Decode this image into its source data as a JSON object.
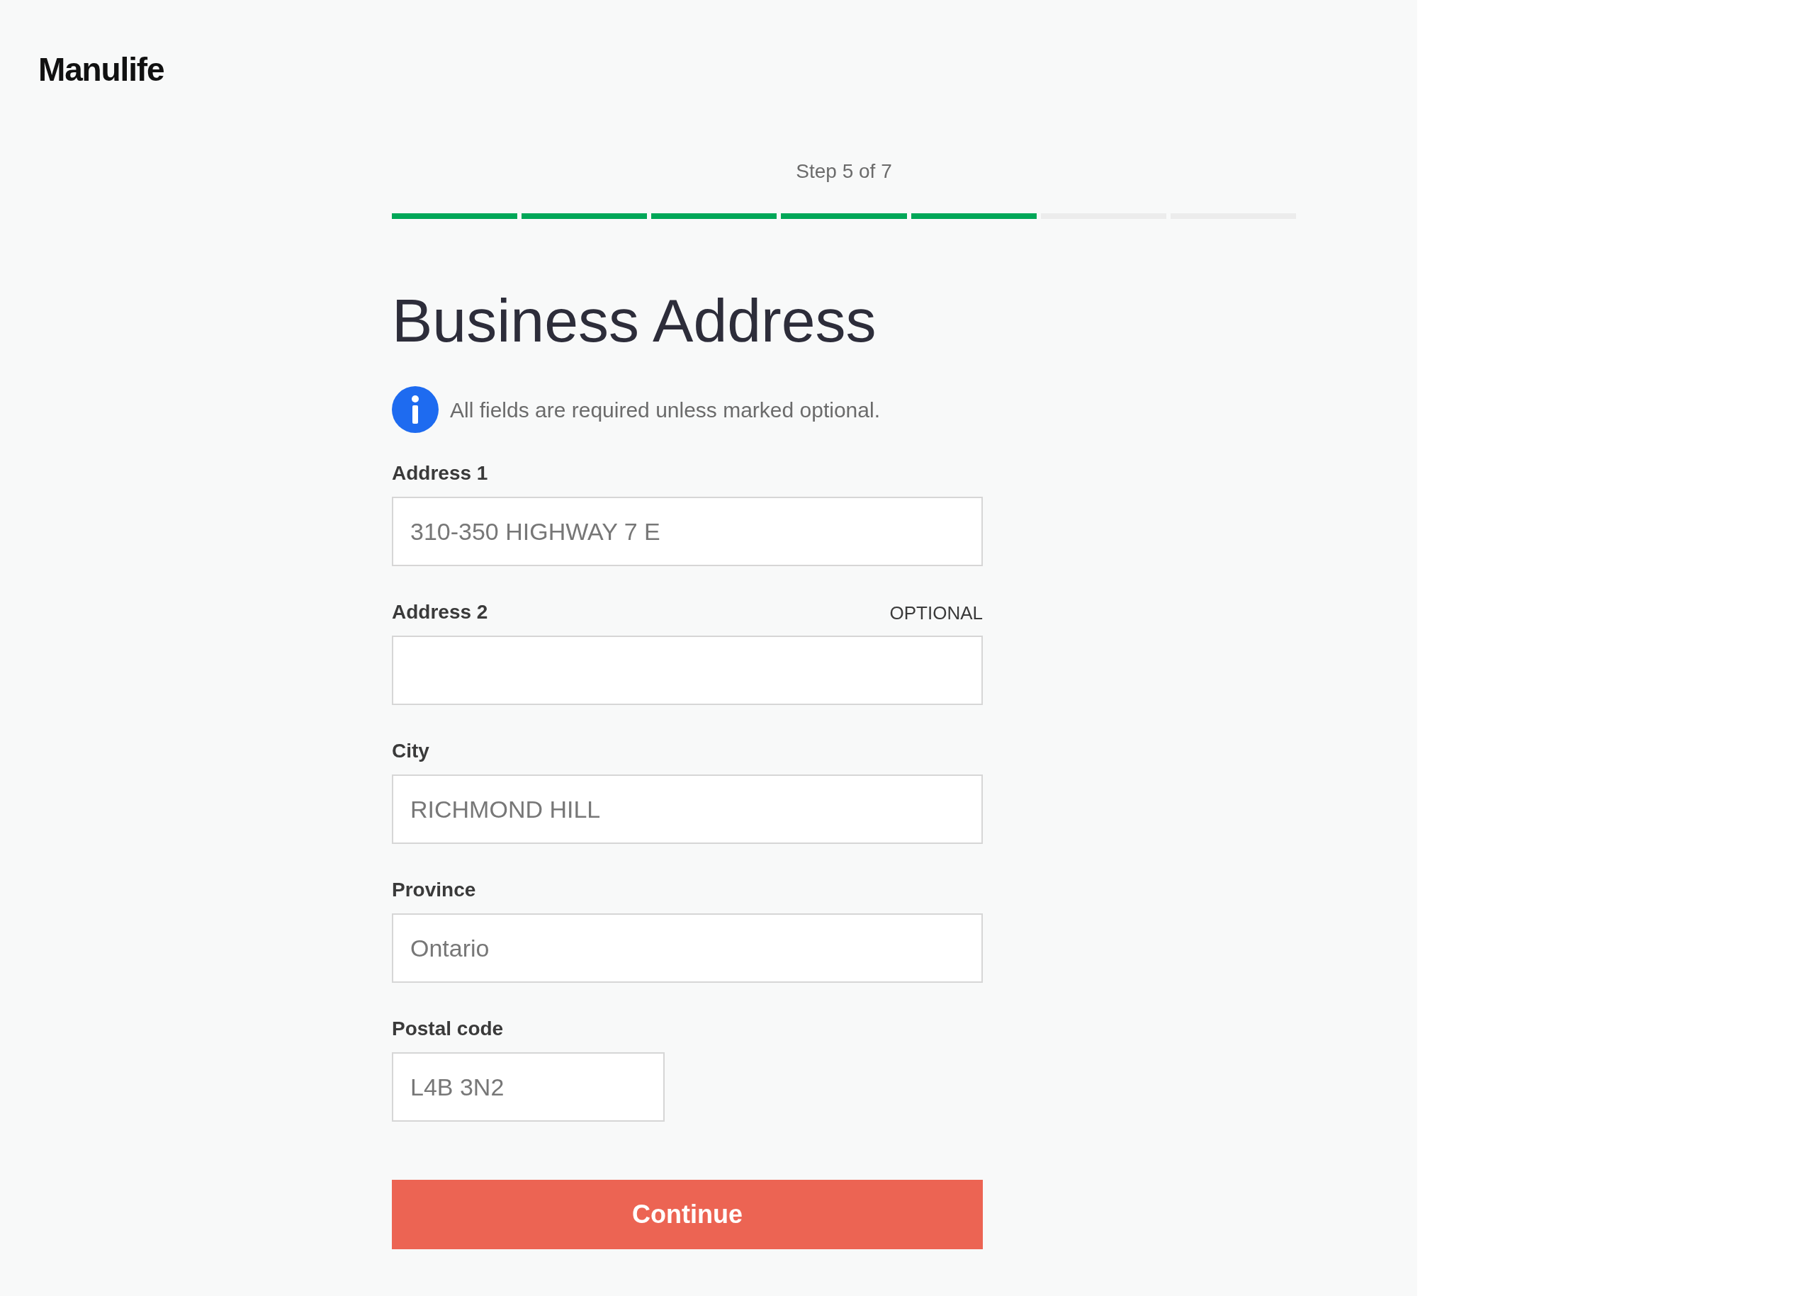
{
  "logo": "Manulife",
  "progress": {
    "label": "Step 5 of 7",
    "segments": [
      {
        "completed": true
      },
      {
        "completed": true
      },
      {
        "completed": true
      },
      {
        "completed": true
      },
      {
        "completed": true
      },
      {
        "completed": false
      },
      {
        "completed": false
      }
    ]
  },
  "title": "Business Address",
  "notice": "All fields are required unless marked optional.",
  "fields": [
    {
      "label": "Address 1",
      "value": "310-350 HIGHWAY 7 E",
      "kind": "full"
    },
    {
      "label": "Address 2",
      "optional_tag": "OPTIONAL",
      "kind": "full"
    },
    {
      "label": "City",
      "value": "RICHMOND HILL",
      "kind": "full"
    },
    {
      "label": "Province",
      "value": "Ontario",
      "kind": "full"
    },
    {
      "label": "Postal code",
      "value": "L4B 3N2",
      "kind": "short"
    }
  ],
  "button": "Continue"
}
